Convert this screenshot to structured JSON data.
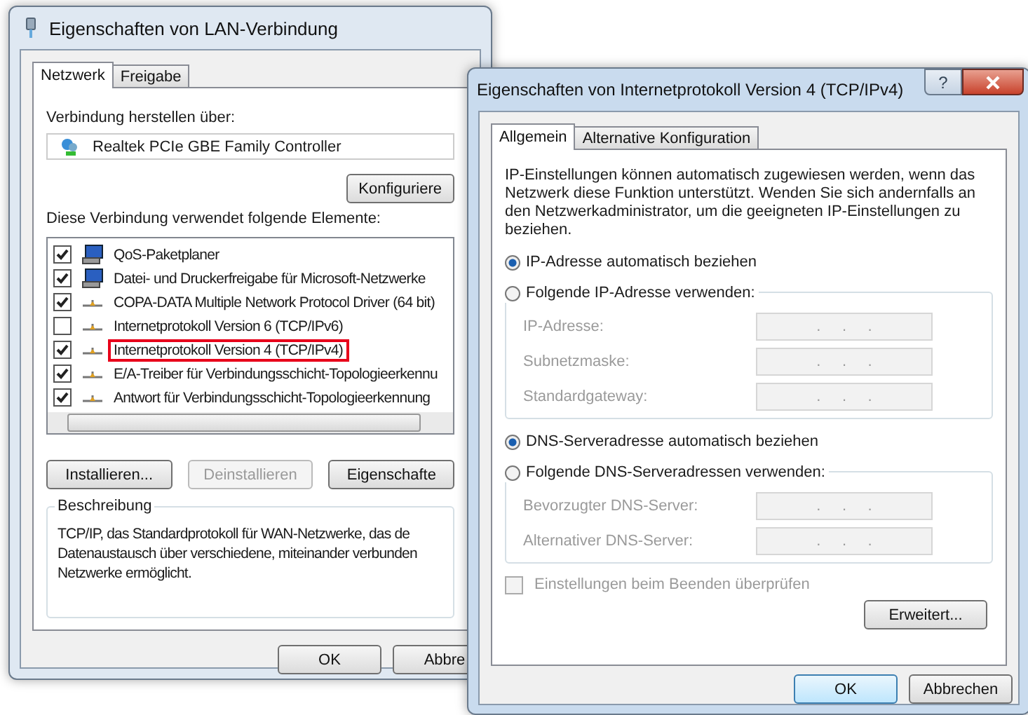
{
  "lan_dialog": {
    "title": "Eigenschaften von LAN-Verbindung",
    "tabs": [
      {
        "label": "Netzwerk",
        "selected": true
      },
      {
        "label": "Freigabe",
        "selected": false
      }
    ],
    "connect_label": "Verbindung herstellen über:",
    "adapter": "Realtek PCIe GBE Family Controller",
    "configure_button": "Konfiguriere",
    "elements_label": "Diese Verbindung verwendet folgende Elemente:",
    "elements": [
      {
        "kind": "service",
        "label": "QoS-Paketplaner",
        "checked": true,
        "highlighted": false
      },
      {
        "kind": "service",
        "label": "Datei- und Druckerfreigabe für Microsoft-Netzwerke",
        "checked": true,
        "highlighted": false
      },
      {
        "kind": "protocol",
        "label": "COPA-DATA Multiple Network Protocol Driver (64 bit)",
        "checked": true,
        "highlighted": false
      },
      {
        "kind": "protocol",
        "label": "Internetprotokoll Version 6 (TCP/IPv6)",
        "checked": false,
        "highlighted": false
      },
      {
        "kind": "protocol",
        "label": "Internetprotokoll Version 4 (TCP/IPv4)",
        "checked": true,
        "highlighted": true
      },
      {
        "kind": "protocol",
        "label": "E/A-Treiber für Verbindungsschicht-Topologieerkennu",
        "checked": true,
        "highlighted": false
      },
      {
        "kind": "protocol",
        "label": "Antwort für Verbindungsschicht-Topologieerkennung",
        "checked": true,
        "highlighted": false
      }
    ],
    "buttons": [
      {
        "label": "Installieren...",
        "disabled": false
      },
      {
        "label": "Deinstallieren",
        "disabled": true
      },
      {
        "label": "Eigenschafte",
        "disabled": false
      }
    ],
    "description_label": "Beschreibung",
    "description_lines": [
      "TCP/IP, das Standardprotokoll für WAN-Netzwerke, das de",
      "Datenaustausch über verschiedene, miteinander verbunden",
      "Netzwerke ermöglicht."
    ],
    "ok_button": "OK",
    "cancel_button": "Abbre"
  },
  "ipv4_dialog": {
    "title": "Eigenschaften von Internetprotokoll Version 4 (TCP/IPv4)",
    "help_button": "?",
    "tabs": [
      {
        "label": "Allgemein",
        "selected": true
      },
      {
        "label": "Alternative Konfiguration",
        "selected": false
      }
    ],
    "intro": "IP-Einstellungen können automatisch zugewiesen werden, wenn das Netzwerk diese Funktion unterstützt. Wenden Sie sich andernfalls an den Netzwerkadministrator, um die geeigneten IP-Einstellungen zu beziehen.",
    "ip_options": [
      {
        "label": "IP-Adresse automatisch beziehen",
        "selected": true
      },
      {
        "label": "Folgende IP-Adresse verwenden:",
        "selected": false
      }
    ],
    "ip_fields": [
      {
        "label": "IP-Adresse:",
        "value": ".     .     .",
        "disabled": true
      },
      {
        "label": "Subnetzmaske:",
        "value": ".     .     .",
        "disabled": true
      },
      {
        "label": "Standardgateway:",
        "value": ".     .     .",
        "disabled": true
      }
    ],
    "dns_options": [
      {
        "label": "DNS-Serveradresse automatisch beziehen",
        "selected": true
      },
      {
        "label": "Folgende DNS-Serveradressen verwenden:",
        "selected": false
      }
    ],
    "dns_fields": [
      {
        "label": "Bevorzugter DNS-Server:",
        "value": ".     .     .",
        "disabled": true
      },
      {
        "label": "Alternativer DNS-Server:",
        "value": ".     .     .",
        "disabled": true
      }
    ],
    "validate_checkbox": {
      "label": "Einstellungen beim Beenden überprüfen",
      "checked": false,
      "disabled": true
    },
    "advanced_button": "Erweitert...",
    "ok_button": "OK",
    "cancel_button": "Abbrechen"
  }
}
